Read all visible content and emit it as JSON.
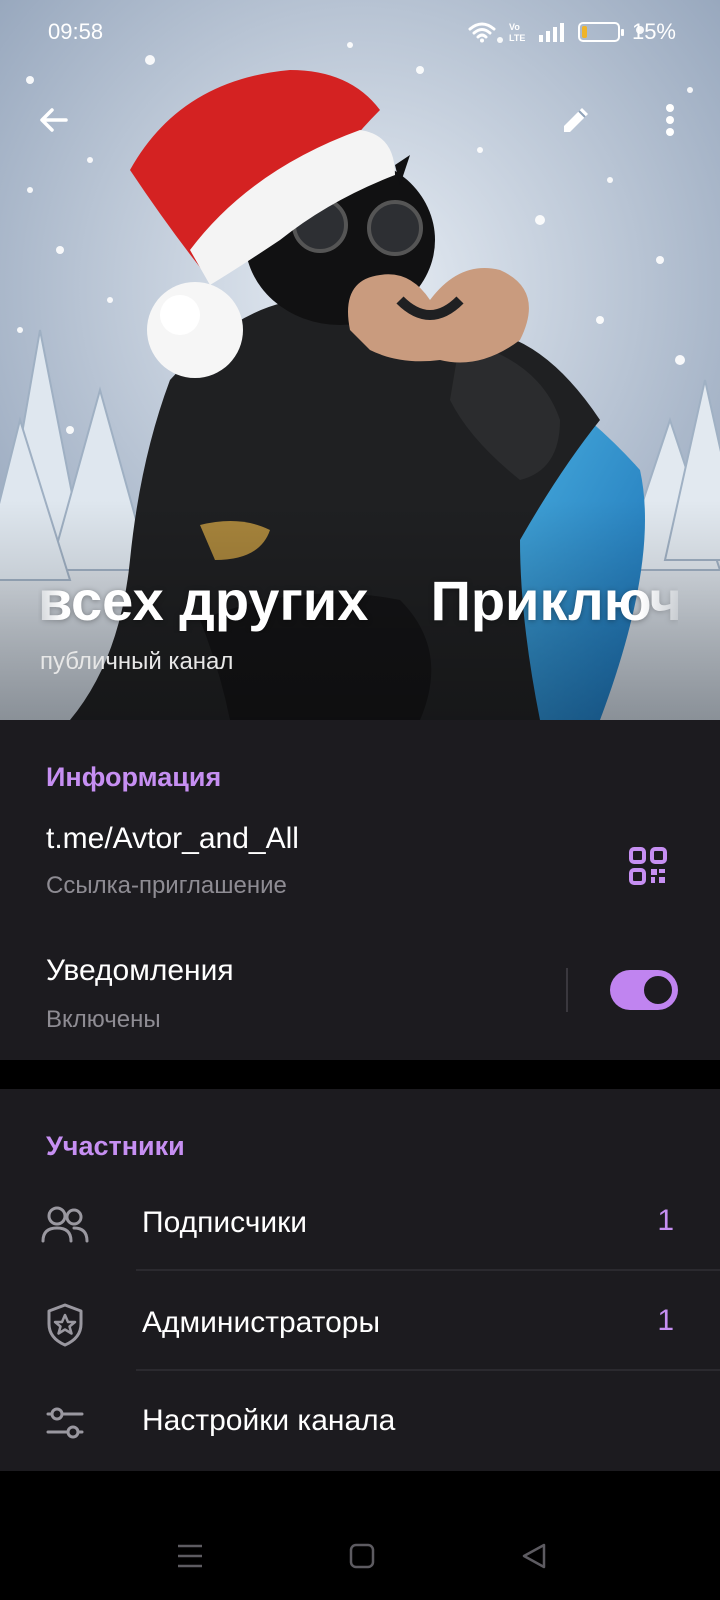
{
  "status_bar": {
    "time": "09:58",
    "battery_percent": "15%",
    "battery_level": 0.15,
    "network_label": "Vo LTE",
    "icons": [
      "wifi-icon",
      "volte-icon",
      "signal-icon",
      "battery-icon"
    ]
  },
  "toolbar": {
    "back_icon": "arrow-left-icon",
    "edit_icon": "pencil-icon",
    "more_icon": "more-vertical-icon"
  },
  "channel": {
    "title": "всех других    Приключ",
    "subtitle": "публичный канал"
  },
  "info_section": {
    "header": "Информация",
    "link": "t.me/Avtor_and_All",
    "link_caption": "Ссылка-приглашение",
    "qr_icon": "qr-code-icon",
    "notifications_title": "Уведомления",
    "notifications_status": "Включены",
    "notifications_enabled": true
  },
  "members_section": {
    "header": "Участники",
    "items": [
      {
        "label": "Подписчики",
        "count": "1",
        "icon": "people-icon"
      },
      {
        "label": "Администраторы",
        "count": "1",
        "icon": "shield-star-icon"
      },
      {
        "label": "Настройки канала",
        "count": "",
        "icon": "sliders-icon"
      }
    ]
  },
  "nav_bar": {
    "icons": [
      "menu-icon",
      "home-square-icon",
      "back-triangle-icon"
    ]
  },
  "colors": {
    "accent": "#c68ff2",
    "toggle": "#c084f0",
    "section_bg": "#1c1b1f",
    "muted_text": "#8e8c93",
    "battery_fill": "#f0b429"
  }
}
